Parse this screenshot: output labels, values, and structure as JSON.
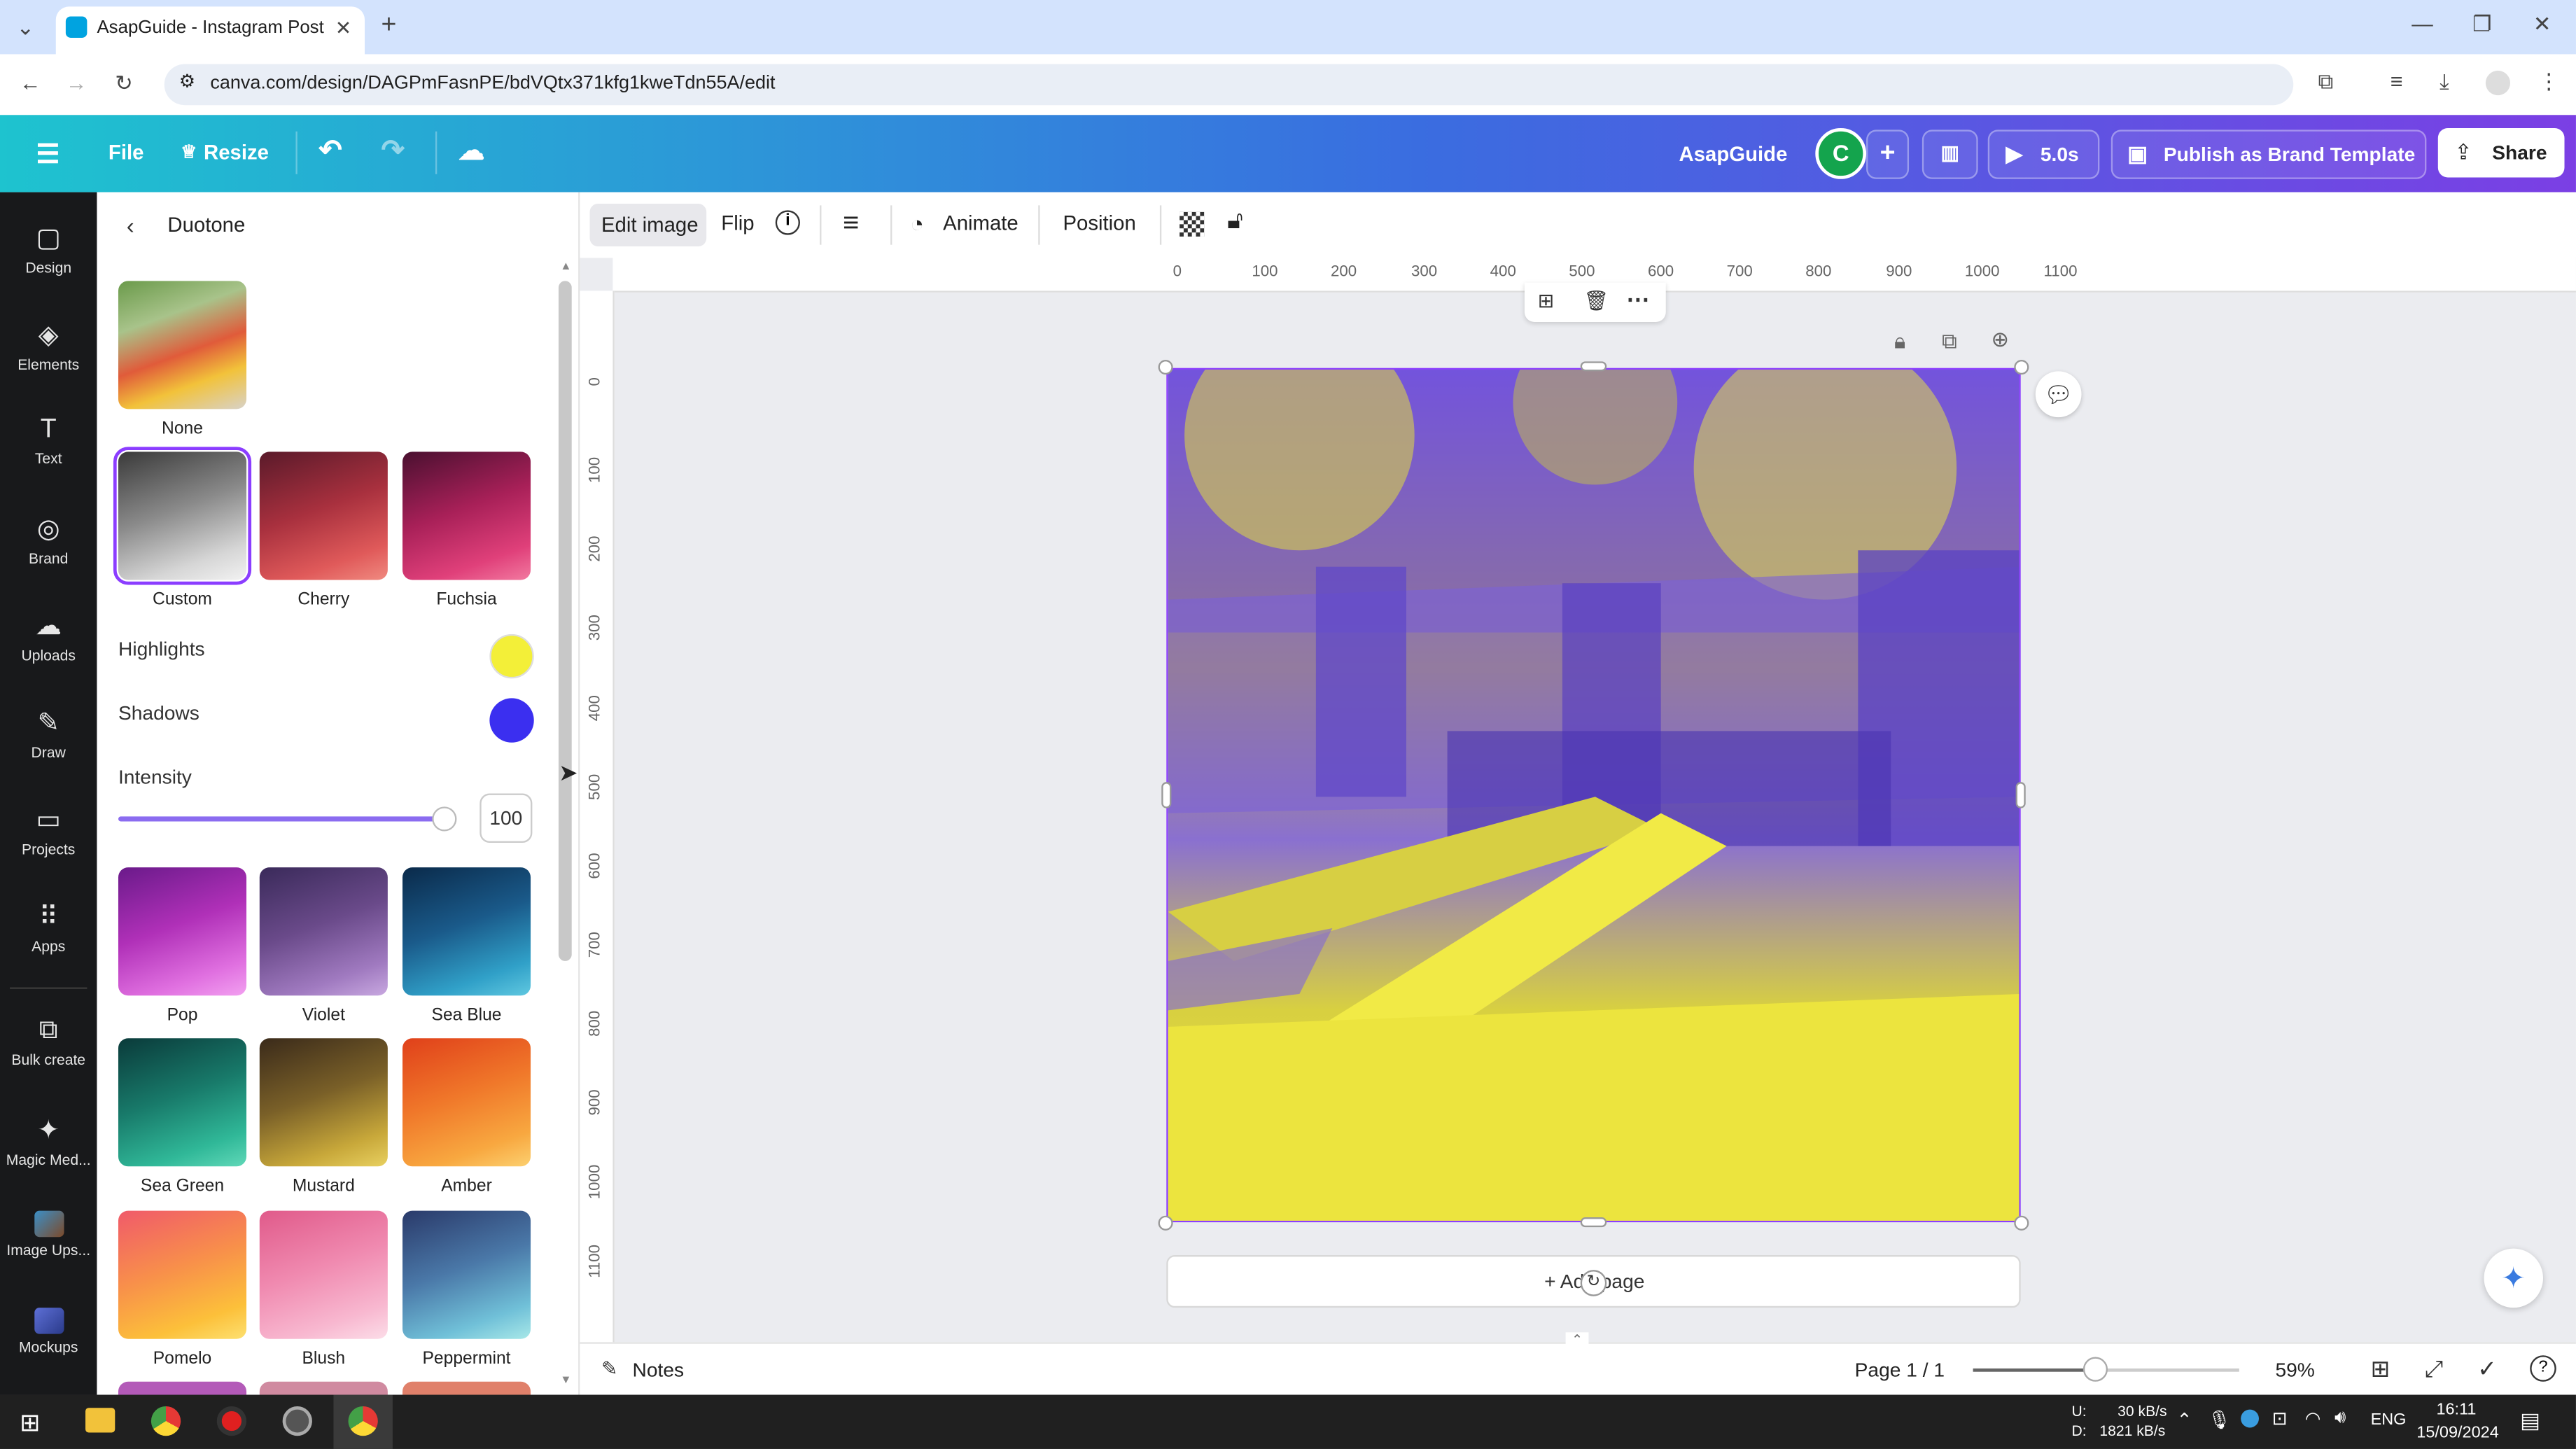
{
  "browser": {
    "tab_title": "AsapGuide - Instagram Post",
    "url": "canva.com/design/DAGPmFasnPE/bdVQtx371kfg1kweTdn55A/edit"
  },
  "header": {
    "file": "File",
    "resize": "Resize",
    "team_name": "AsapGuide",
    "avatar_letter": "C",
    "play_time": "5.0s",
    "publish": "Publish as Brand Template",
    "share": "Share"
  },
  "rail": [
    {
      "label": "Design",
      "icon": "design-icon"
    },
    {
      "label": "Elements",
      "icon": "elements-icon"
    },
    {
      "label": "Text",
      "icon": "text-icon"
    },
    {
      "label": "Brand",
      "icon": "brand-icon"
    },
    {
      "label": "Uploads",
      "icon": "uploads-icon"
    },
    {
      "label": "Draw",
      "icon": "draw-icon"
    },
    {
      "label": "Projects",
      "icon": "projects-icon"
    },
    {
      "label": "Apps",
      "icon": "apps-icon"
    },
    {
      "label": "Bulk create",
      "icon": "bulk-create-icon"
    },
    {
      "label": "Magic Med...",
      "icon": "magic-media-icon"
    },
    {
      "label": "Image Ups...",
      "icon": "image-upscaler-icon"
    },
    {
      "label": "Mockups",
      "icon": "mockups-icon"
    }
  ],
  "panel": {
    "title": "Duotone",
    "none_label": "None",
    "presets_top": [
      "Custom",
      "Cherry",
      "Fuchsia"
    ],
    "highlights_label": "Highlights",
    "highlights_color": "#f3ef38",
    "shadows_label": "Shadows",
    "shadows_color": "#3b2ff0",
    "intensity_label": "Intensity",
    "intensity_value": "100",
    "presets": [
      "Pop",
      "Violet",
      "Sea Blue",
      "Sea Green",
      "Mustard",
      "Amber",
      "Pomelo",
      "Blush",
      "Peppermint"
    ]
  },
  "toolbar": {
    "edit_image": "Edit image",
    "flip": "Flip",
    "animate": "Animate",
    "position": "Position"
  },
  "ruler": {
    "top": [
      "0",
      "100",
      "200",
      "300",
      "400",
      "500",
      "600",
      "700",
      "800",
      "900",
      "1000",
      "1100"
    ],
    "left": [
      "0",
      "100",
      "200",
      "300",
      "400",
      "500",
      "600",
      "700",
      "800",
      "900",
      "1000",
      "1100"
    ]
  },
  "canvas": {
    "add_page": "+ Add page"
  },
  "footer": {
    "notes": "Notes",
    "page": "Page 1 / 1",
    "zoom": "59%"
  },
  "taskbar": {
    "net_up": "30 kB/s",
    "net_down": "1821 kB/s",
    "net_u": "U:",
    "net_d": "D:",
    "lang": "ENG",
    "time": "16:11",
    "date": "15/09/2024"
  }
}
